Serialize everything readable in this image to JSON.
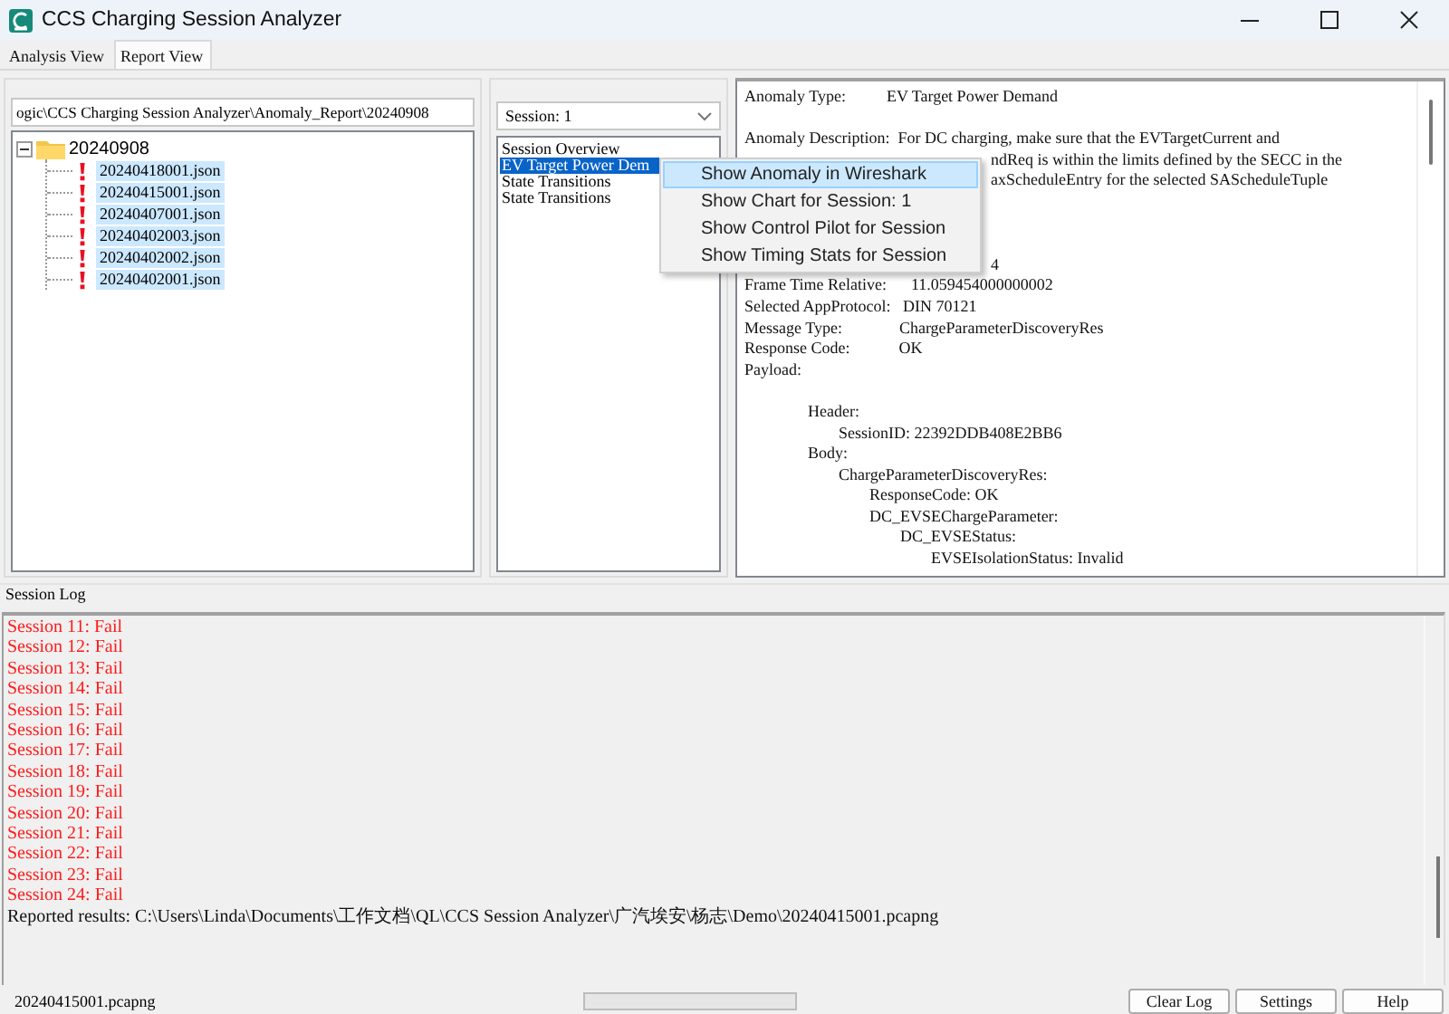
{
  "window": {
    "title": "CCS Charging Session Analyzer"
  },
  "tabs": [
    {
      "label": "Analysis View",
      "selected": false
    },
    {
      "label": "Report View",
      "selected": true
    }
  ],
  "report_path": {
    "value": "ogic\\CCS Charging Session Analyzer\\Anomaly_Report\\20240908"
  },
  "tree": {
    "label": "20240908",
    "expanded": true,
    "children": [
      {
        "label": "20240418001.json",
        "selected": true
      },
      {
        "label": "20240415001.json",
        "selected": true
      },
      {
        "label": "20240407001.json",
        "selected": true
      },
      {
        "label": "20240402003.json",
        "selected": true
      },
      {
        "label": "20240402002.json",
        "selected": true
      },
      {
        "label": "20240402001.json",
        "selected": true
      }
    ]
  },
  "session_select": {
    "value": "Session: 1"
  },
  "anomaly_list": [
    {
      "label": "Session Overview",
      "selected": false
    },
    {
      "label": "EV Target Power Dem",
      "selected": true
    },
    {
      "label": "State Transitions",
      "selected": false
    },
    {
      "label": "State Transitions",
      "selected": false
    }
  ],
  "details": [
    {
      "kind": "text",
      "text": "Anomaly Type:          EV Target Power Demand"
    },
    {
      "kind": "gap"
    },
    {
      "kind": "text",
      "text": "Anomaly Description:  For DC charging, make sure that the EVTargetCurrent and"
    },
    {
      "kind": "after_menu",
      "text": "ndReq is within the limits defined by the SECC in the"
    },
    {
      "kind": "after_menu",
      "text": "axScheduleEntry for the selected SAScheduleTuple"
    },
    {
      "kind": "gap"
    },
    {
      "kind": "gap"
    },
    {
      "kind": "gap"
    },
    {
      "kind": "after_menu",
      "text": "4"
    },
    {
      "kind": "text",
      "text": "Frame Time Relative:      11.059454000000002"
    },
    {
      "kind": "text",
      "text": "Selected AppProtocol:   DIN 70121"
    },
    {
      "kind": "text",
      "text": "Message Type:              ChargeParameterDiscoveryRes"
    },
    {
      "kind": "text",
      "text": "Response Code:            OK"
    },
    {
      "kind": "text",
      "text": "Payload:",
      "children": [
        {
          "kind": "gap"
        },
        {
          "kind": "text",
          "text": "Header:",
          "children": [
            {
              "kind": "text",
              "text": "SessionID: 22392DDB408E2BB6"
            }
          ]
        },
        {
          "kind": "text",
          "text": "Body:",
          "children": [
            {
              "kind": "text",
              "text": "ChargeParameterDiscoveryRes:",
              "children": [
                {
                  "kind": "text",
                  "text": "ResponseCode: OK"
                },
                {
                  "kind": "text",
                  "text": "DC_EVSEChargeParameter:",
                  "children": [
                    {
                      "kind": "text",
                      "text": "DC_EVSEStatus:",
                      "children": [
                        {
                          "kind": "text",
                          "text": "EVSEIsolationStatus: Invalid"
                        }
                      ]
                    }
                  ]
                }
              ]
            }
          ]
        }
      ]
    }
  ],
  "context_menu": [
    {
      "label": "Show Anomaly in Wireshark",
      "selected": true
    },
    {
      "label": "Show Chart for Session: 1",
      "selected": false
    },
    {
      "label": "Show Control Pilot for Session",
      "selected": false
    },
    {
      "label": "Show Timing Stats for Session",
      "selected": false
    }
  ],
  "session_log": {
    "title": "Session Log",
    "lines": [
      {
        "kind": "fail",
        "text": "Session 11: Fail"
      },
      {
        "kind": "fail",
        "text": "Session 12: Fail"
      },
      {
        "kind": "fail",
        "text": "Session 13: Fail"
      },
      {
        "kind": "fail",
        "text": "Session 14: Fail"
      },
      {
        "kind": "fail",
        "text": "Session 15: Fail"
      },
      {
        "kind": "fail",
        "text": "Session 16: Fail"
      },
      {
        "kind": "fail",
        "text": "Session 17: Fail"
      },
      {
        "kind": "fail",
        "text": "Session 18: Fail"
      },
      {
        "kind": "fail",
        "text": "Session 19: Fail"
      },
      {
        "kind": "fail",
        "text": "Session 20: Fail"
      },
      {
        "kind": "fail",
        "text": "Session 21: Fail"
      },
      {
        "kind": "fail",
        "text": "Session 22: Fail"
      },
      {
        "kind": "fail",
        "text": "Session 23: Fail"
      },
      {
        "kind": "fail",
        "text": "Session 24: Fail"
      },
      {
        "kind": "info",
        "text": "Reported results: C:\\Users\\Linda\\Documents\\工作文档\\QL\\CCS Session Analyzer\\广汽埃安\\杨志\\Demo\\20240415001.pcapng"
      }
    ]
  },
  "status_bar": {
    "file": "20240415001.pcapng",
    "progress": {
      "level": 0
    },
    "buttons": [
      "Clear Log",
      "Settings",
      "Help"
    ]
  }
}
